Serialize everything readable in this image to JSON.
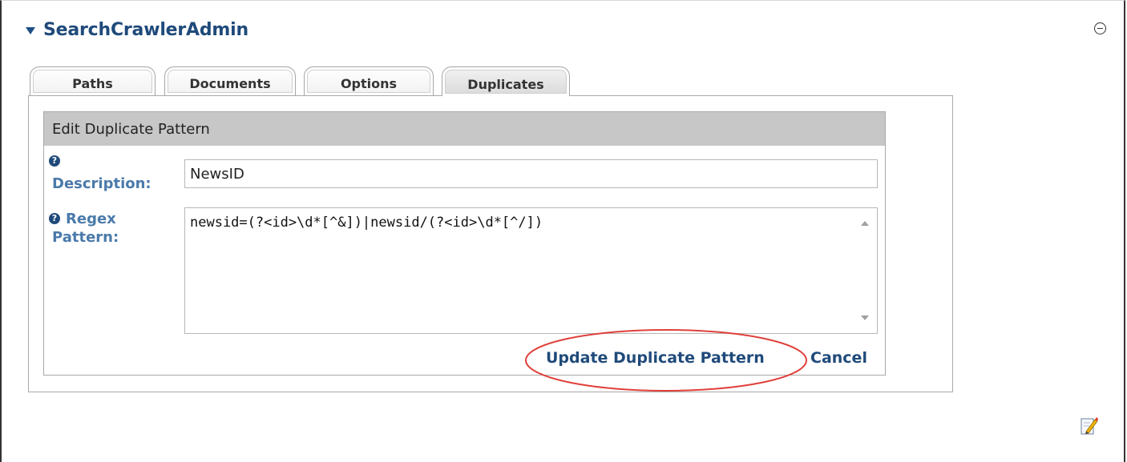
{
  "module": {
    "title": "SearchCrawlerAdmin",
    "collapse_icon": "triangle-down-icon",
    "minimize_icon": "circle-minus-icon"
  },
  "tabs": [
    {
      "label": "Paths",
      "active": false
    },
    {
      "label": "Documents",
      "active": false
    },
    {
      "label": "Options",
      "active": false
    },
    {
      "label": "Duplicates",
      "active": true
    }
  ],
  "edit_form": {
    "header": "Edit Duplicate Pattern",
    "help_icon": "question-circle-icon",
    "description": {
      "label": "Description:",
      "value": "NewsID"
    },
    "regex": {
      "label_line1": "Regex",
      "label_line2": "Pattern:",
      "value": "newsid=(?<id>\\d*[^&])|newsid/(?<id>\\d*[^/])"
    },
    "actions": {
      "update_label": "Update Duplicate Pattern",
      "cancel_label": "Cancel"
    }
  },
  "annotation": {
    "highlight_color": "#e0403a"
  },
  "footer": {
    "edit_icon": "pencil-edit-icon"
  },
  "colors": {
    "link": "#1f4a7a",
    "label": "#4a7aaa",
    "header_bg": "#c7c7c7"
  }
}
